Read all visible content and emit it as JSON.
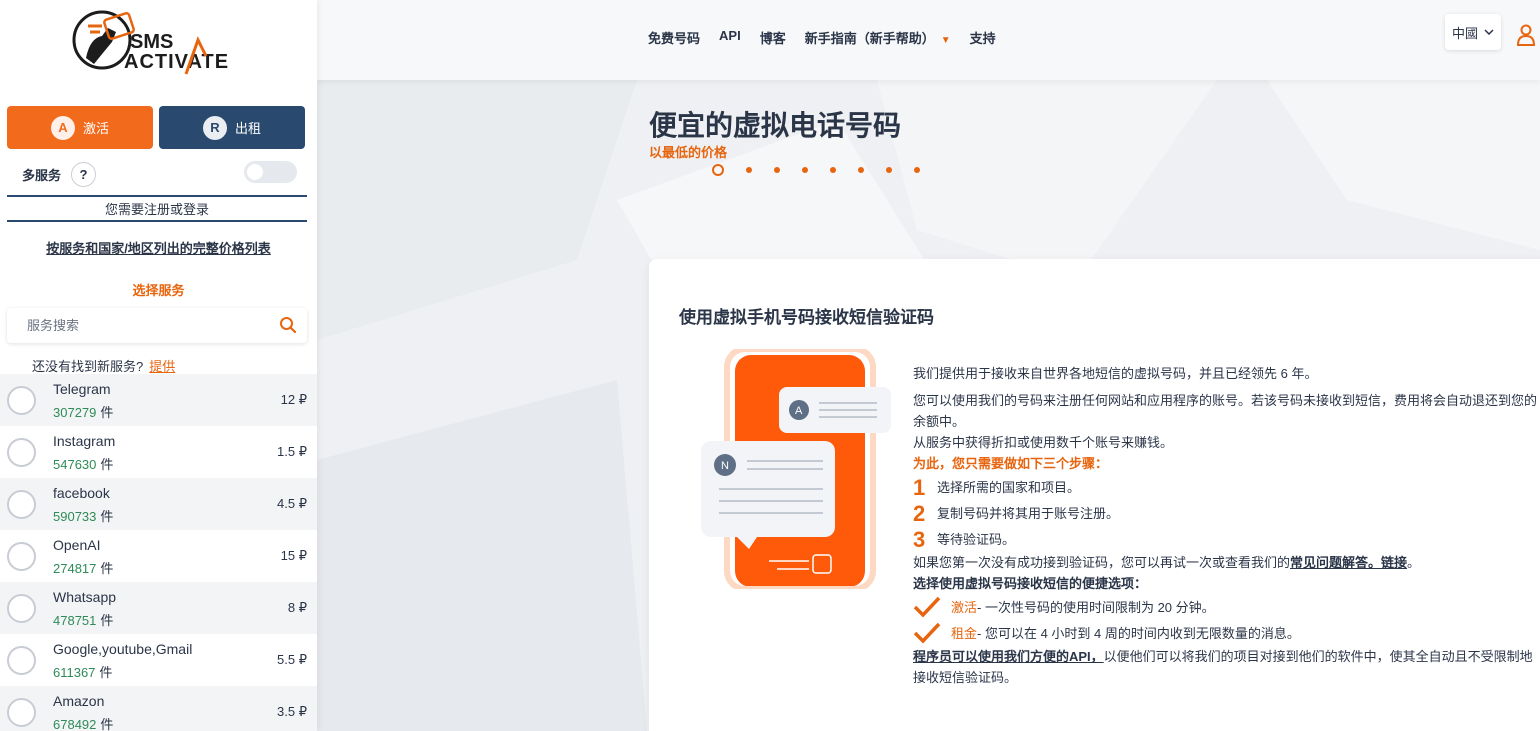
{
  "brand": {
    "logo_line1": "SMS",
    "logo_line2": "ACTIVATE"
  },
  "sidebar": {
    "activate_label": "激活",
    "rent_label": "出租",
    "multi_service_label": "多服务",
    "help_mark": "?",
    "login_text": "您需要注册或登录",
    "price_list_link": "按服务和国家/地区列出的完整价格列表",
    "select_service_title": "选择服务",
    "search_placeholder": "服务搜索",
    "not_found_text": "还没有找到新服务?",
    "provide_link": "提供",
    "count_unit": "件",
    "services": [
      {
        "name": "Telegram",
        "count": "307279",
        "price": "12 ₽"
      },
      {
        "name": "Instagram",
        "count": "547630",
        "price": "1.5 ₽"
      },
      {
        "name": "facebook",
        "count": "590733",
        "price": "4.5 ₽"
      },
      {
        "name": "OpenAI",
        "count": "274817",
        "price": "15 ₽"
      },
      {
        "name": "Whatsapp",
        "count": "478751",
        "price": "8 ₽"
      },
      {
        "name": "Google,youtube,Gmail",
        "count": "611367",
        "price": "5.5 ₽"
      },
      {
        "name": "Amazon",
        "count": "678492",
        "price": "3.5 ₽"
      }
    ]
  },
  "header": {
    "nav": [
      "免费号码",
      "API",
      "博客",
      "新手指南（新手帮助）",
      "支持"
    ],
    "language": "中國"
  },
  "hero": {
    "title": "便宜的虚拟电话号码",
    "subtitle": "以最低的价格",
    "slide_count": 8,
    "active_slide": 1
  },
  "card": {
    "title": "使用虚拟手机号码接收短信验证码",
    "illus_badge_a": "A",
    "illus_badge_n": "N",
    "para1": "我们提供用于接收来自世界各地短信的虚拟号码，并且已经领先 6 年。",
    "para2": "您可以使用我们的号码来注册任何网站和应用程序的账号。若该号码未接收到短信，费用将会自动退还到您的余额中。",
    "para3": "从服务中获得折扣或使用数千个账号来赚钱。",
    "steps_title": "为此，您只需要做如下三个步骤：",
    "steps": [
      {
        "num": "1",
        "text": "选择所需的国家和项目。"
      },
      {
        "num": "2",
        "text": "复制号码并将其用于账号注册。"
      },
      {
        "num": "3",
        "text": "等待验证码。"
      }
    ],
    "retry_text": "如果您第一次没有成功接到验证码，您可以再试一次或查看我们的",
    "faq_link": "常见问题解答。链接",
    "retry_end": "。",
    "options_title": "选择使用虚拟号码接收短信的便捷选项：",
    "option1_name": "激活",
    "option1_text": " - 一次性号码的使用时间限制为 20 分钟。",
    "option2_name": "租金",
    "option2_text": " - 您可以在 4 小时到 4 周的时间内收到无限数量的消息。",
    "api_link": "程序员可以使用我们方便的API，",
    "api_text": "以便他们可以将我们的项目对接到他们的软件中，使其全自动且不受限制地接收短信验证码。"
  },
  "colors": {
    "accent": "#e8650f",
    "navy": "#294a6e",
    "count_green": "#2e8b57"
  }
}
